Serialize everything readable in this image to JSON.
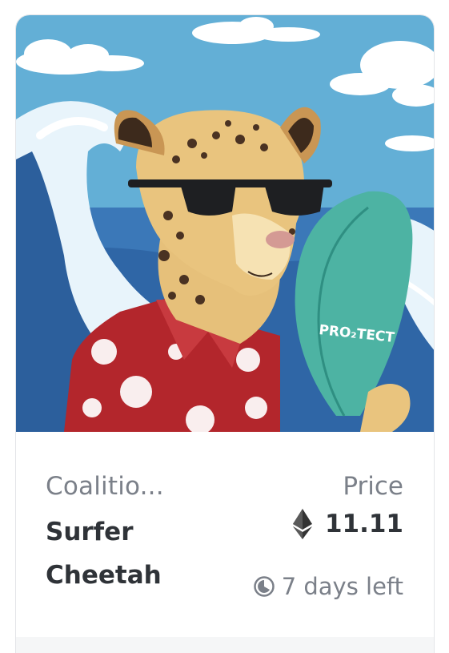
{
  "card": {
    "image": {
      "alt": "Surfer Cheetah artwork",
      "board_text": "PRO₂TECT"
    },
    "collection": "Coalitio...",
    "name_line1": "Surfer",
    "name_line2": "Cheetah",
    "price_label": "Price",
    "currency_icon": "ethereum-icon",
    "price_value": "11.11",
    "time_icon": "clock-icon",
    "time_left": "7 days left"
  },
  "colors": {
    "title_text": "#2f3338",
    "muted_text": "#7b8089",
    "card_border": "#e3e5e8",
    "footer_bg": "#f5f6f7"
  }
}
